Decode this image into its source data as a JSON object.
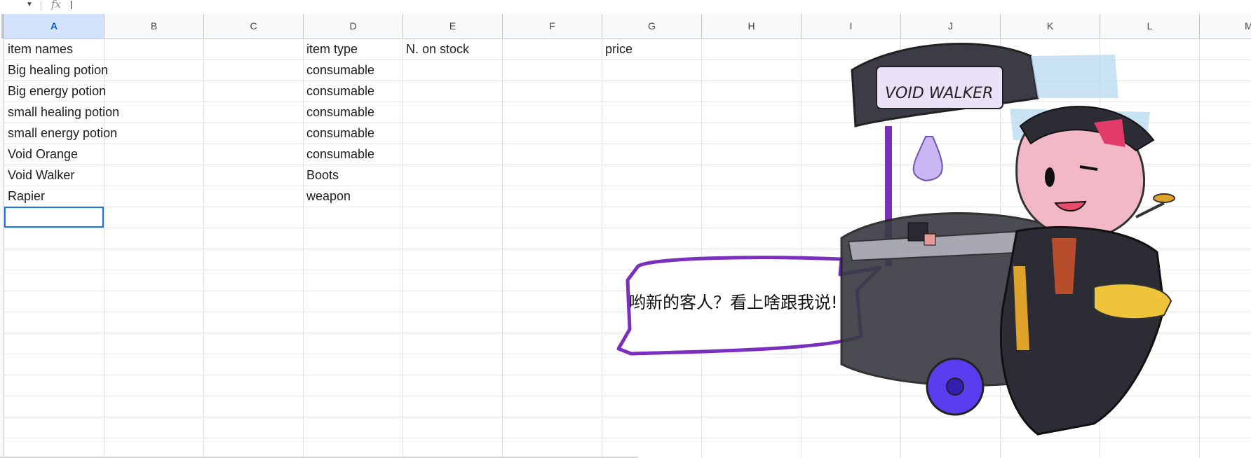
{
  "formula_bar": {
    "fx_label": "fx",
    "value": ""
  },
  "columns": [
    "A",
    "B",
    "C",
    "D",
    "E",
    "F",
    "G",
    "H",
    "I",
    "J",
    "K",
    "L",
    "M"
  ],
  "selected_column": "A",
  "sheet": {
    "headers": {
      "item_names": "item names",
      "item_type": "item type",
      "stock": "N. on stock",
      "price": "price"
    },
    "rows": [
      {
        "name": "Big healing potion",
        "type": "consumable"
      },
      {
        "name": "Big energy potion",
        "type": "consumable"
      },
      {
        "name": "small healing potion",
        "type": "consumable"
      },
      {
        "name": "small energy potion",
        "type": "consumable"
      },
      {
        "name": "Void Orange",
        "type": "consumable"
      },
      {
        "name": "Void Walker",
        "type": "Boots"
      },
      {
        "name": "Rapier",
        "type": "weapon"
      }
    ]
  },
  "drawing": {
    "speech_bubble": "哟新的客人？看上啥跟我说!",
    "shop_sign": "VOID WALKER"
  },
  "colors": {
    "selection": "#1a73e8",
    "bubble_outline": "#7b2fbf",
    "cart": "#3c3c46"
  }
}
